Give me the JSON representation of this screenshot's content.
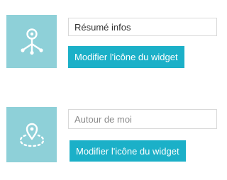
{
  "widgets": [
    {
      "icon": "pin-network-icon",
      "name_value": "Résumé infos",
      "name_placeholder": "",
      "button_label": "Modifier l'icône du widget"
    },
    {
      "icon": "pin-radius-icon",
      "name_value": "",
      "name_placeholder": "Autour de moi",
      "button_label": "Modifier l'icône du widget"
    }
  ],
  "colors": {
    "icon_tile": "#8ed0d8",
    "button": "#1bb0c8",
    "icon_glyph": "#ffffff"
  }
}
